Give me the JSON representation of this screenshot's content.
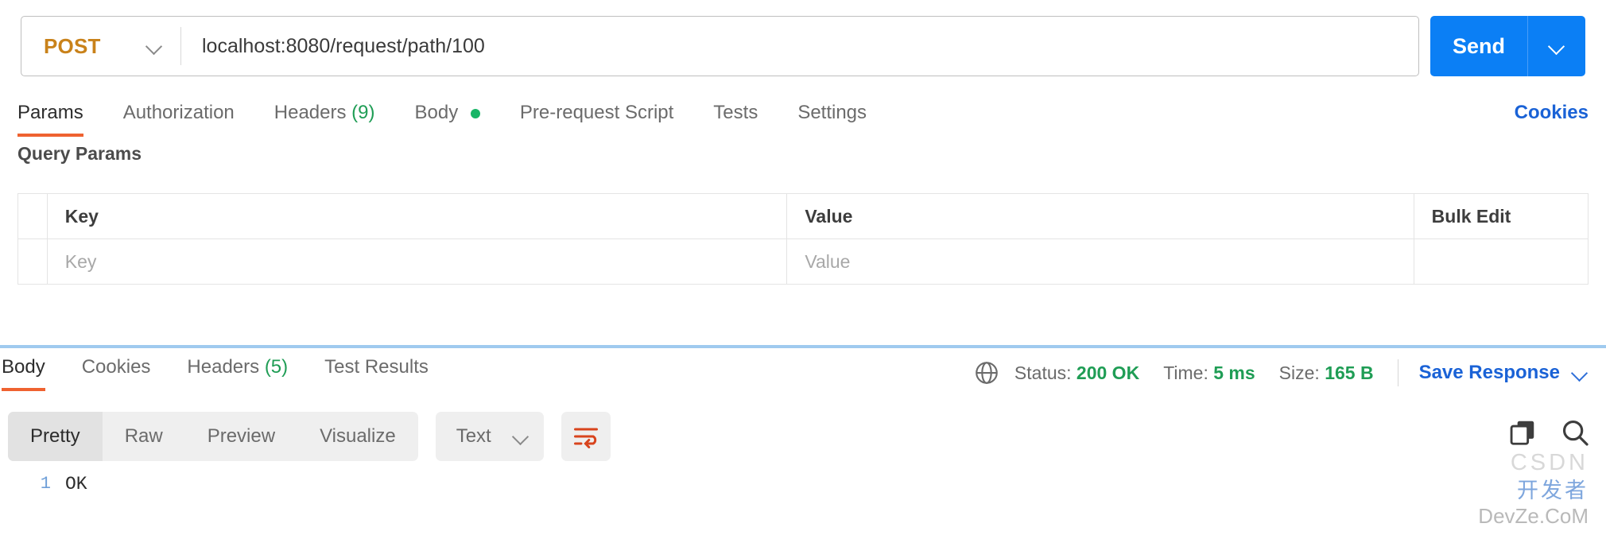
{
  "request": {
    "method": "POST",
    "url": "localhost:8080/request/path/100",
    "send_label": "Send",
    "tabs": [
      {
        "label": "Params",
        "count": "",
        "active": true,
        "dot": false
      },
      {
        "label": "Authorization",
        "count": "",
        "active": false,
        "dot": false
      },
      {
        "label": "Headers",
        "count": "(9)",
        "active": false,
        "dot": false
      },
      {
        "label": "Body",
        "count": "",
        "active": false,
        "dot": true
      },
      {
        "label": "Pre-request Script",
        "count": "",
        "active": false,
        "dot": false
      },
      {
        "label": "Tests",
        "count": "",
        "active": false,
        "dot": false
      },
      {
        "label": "Settings",
        "count": "",
        "active": false,
        "dot": false
      }
    ],
    "cookies_link": "Cookies"
  },
  "query_params": {
    "section_title": "Query Params",
    "headers": {
      "key": "Key",
      "value": "Value",
      "bulk": "Bulk Edit"
    },
    "rows": [
      {
        "key_placeholder": "Key",
        "value_placeholder": "Value"
      }
    ]
  },
  "response": {
    "tabs": [
      {
        "label": "Body",
        "count": "",
        "active": true
      },
      {
        "label": "Cookies",
        "count": "",
        "active": false
      },
      {
        "label": "Headers",
        "count": "(5)",
        "active": false
      },
      {
        "label": "Test Results",
        "count": "",
        "active": false
      }
    ],
    "status_label": "Status:",
    "status_value": "200 OK",
    "time_label": "Time:",
    "time_value": "5 ms",
    "size_label": "Size:",
    "size_value": "165 B",
    "save_response": "Save Response",
    "view_modes": [
      {
        "label": "Pretty",
        "active": true
      },
      {
        "label": "Raw",
        "active": false
      },
      {
        "label": "Preview",
        "active": false
      },
      {
        "label": "Visualize",
        "active": false
      }
    ],
    "format_select": "Text",
    "body_lines": [
      {
        "number": "1",
        "text": "OK"
      }
    ]
  },
  "watermark": {
    "line1": "CSDN",
    "line2": "开发者",
    "line3": "DevZe.CoM"
  },
  "colors": {
    "accent_blue": "#0b7ff5",
    "link_blue": "#1a62d6",
    "method_orange": "#c9821a",
    "active_underline": "#ef6230",
    "success_green": "#1f9d55",
    "dot_green": "#18b566",
    "wrap_icon": "#d8441d"
  }
}
